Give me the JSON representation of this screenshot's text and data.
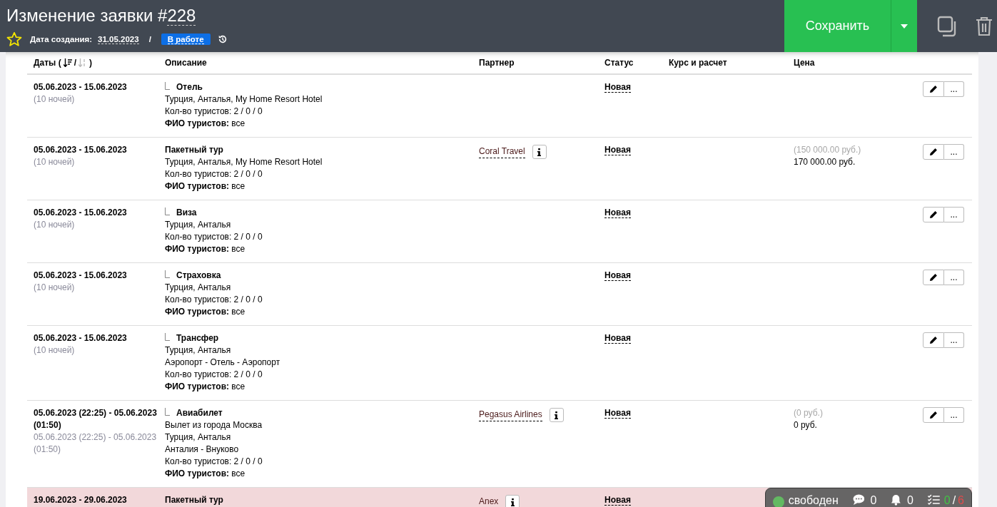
{
  "header": {
    "title": "Изменение заявки #",
    "number": "228",
    "created_label": "Дата создания:",
    "created_date": "31.05.2023",
    "separator": "/",
    "status": "В работе",
    "save_button": "Сохранить"
  },
  "table": {
    "columns": [
      {
        "label": "Даты ("
      },
      {
        "label": "Описание"
      },
      {
        "label": "Партнер"
      },
      {
        "label": "Статус"
      },
      {
        "label": "Курс и расчет"
      },
      {
        "label": "Цена"
      }
    ],
    "sort_separator": "/",
    "sort_close": ")",
    "rows": [
      {
        "dates": "05.06.2023 - 15.06.2023",
        "dates_sub": "(10 ночей)",
        "child": true,
        "title": "Отель",
        "lines": [
          "Турция, Анталья, My Home Resort Hotel",
          "Кол-во туристов: 2 / 0 / 0",
          "**ФИО туристов:** все"
        ],
        "status": "Новая",
        "more": "...",
        "highlighted": false
      },
      {
        "dates": "05.06.2023 - 15.06.2023",
        "dates_sub": "(10 ночей)",
        "child": false,
        "title": "Пакетный тур",
        "lines": [
          "Турция, Анталья, My Home Resort Hotel",
          "Кол-во туристов: 2 / 0 / 0",
          "**ФИО туристов:** все"
        ],
        "partner": "Coral Travel",
        "status": "Новая",
        "price_old": "(150 000.00 руб.)",
        "price": "170 000.00 руб.",
        "more": "...",
        "highlighted": false
      },
      {
        "dates": "05.06.2023 - 15.06.2023",
        "dates_sub": "(10 ночей)",
        "child": true,
        "title": "Виза",
        "lines": [
          "Турция, Анталья",
          "Кол-во туристов: 2 / 0 / 0",
          "**ФИО туристов:** все"
        ],
        "status": "Новая",
        "more": "...",
        "highlighted": false
      },
      {
        "dates": "05.06.2023 - 15.06.2023",
        "dates_sub": "(10 ночей)",
        "child": true,
        "title": "Страховка",
        "lines": [
          "Турция, Анталья",
          "Кол-во туристов: 2 / 0 / 0",
          "**ФИО туристов:** все"
        ],
        "status": "Новая",
        "more": "...",
        "highlighted": false
      },
      {
        "dates": "05.06.2023 - 15.06.2023",
        "dates_sub": "(10 ночей)",
        "child": true,
        "title": "Трансфер",
        "lines": [
          "Турция, Анталья",
          "Аэропорт - Отель - Аэропорт",
          "Кол-во туристов: 2 / 0 / 0",
          "**ФИО туристов:** все"
        ],
        "status": "Новая",
        "more": "...",
        "highlighted": false
      },
      {
        "dates": "05.06.2023 (22:25) - 05.06.2023 (01:50)",
        "dates_sub": "05.06.2023 (22:25) - 05.06.2023 (01:50)",
        "child": true,
        "title": "Авиабилет",
        "lines": [
          "Вылет из города Москва",
          "Турция, Анталья",
          "Анталия - Внуково",
          "Кол-во туристов: 2 / 0 / 0",
          "**ФИО туристов:** все"
        ],
        "partner": "Pegasus Airlines",
        "status": "Новая",
        "price_old": "(0 руб.)",
        "price": "0 руб.",
        "more": "...",
        "highlighted": false
      },
      {
        "dates": "19.06.2023 - 29.06.2023",
        "child": false,
        "title": "Пакетный тур",
        "lines": [],
        "partner": "Anex",
        "status": "Новая",
        "highlighted": true
      }
    ]
  },
  "status_widget": {
    "state": "свободен",
    "color": "#5cb85c",
    "messages": "0",
    "notifications": "0",
    "tasks_done": "0",
    "tasks_sep": "/",
    "tasks_total": "6"
  }
}
